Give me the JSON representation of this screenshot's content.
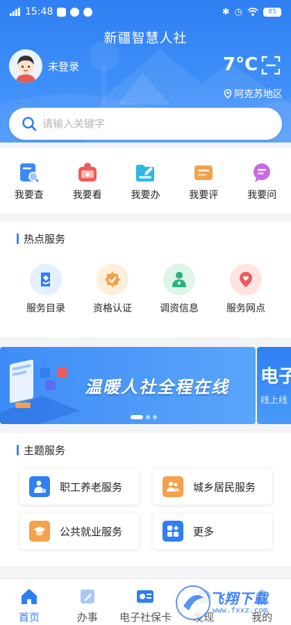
{
  "status_bar": {
    "time": "15:48",
    "battery": "85"
  },
  "header": {
    "app_title": "新疆智慧人社",
    "login_status": "未登录",
    "temperature": "7°C",
    "location": "阿克苏地区"
  },
  "search": {
    "placeholder": "请输入关键字"
  },
  "quick_actions": [
    {
      "label": "我要查",
      "icon": "search-doc-icon"
    },
    {
      "label": "我要看",
      "icon": "monitor-icon"
    },
    {
      "label": "我要办",
      "icon": "folder-edit-icon"
    },
    {
      "label": "我要评",
      "icon": "comment-icon"
    },
    {
      "label": "我要问",
      "icon": "chat-bubble-icon"
    }
  ],
  "hot_services": {
    "title": "热点服务",
    "items": [
      {
        "label": "服务目录",
        "icon": "catalog-icon"
      },
      {
        "label": "资格认证",
        "icon": "certified-badge-icon"
      },
      {
        "label": "调资信息",
        "icon": "person-info-icon"
      },
      {
        "label": "服务网点",
        "icon": "map-pin-icon"
      }
    ]
  },
  "banner": {
    "slide1_text": "温暖人社全程在线",
    "slide2_title": "电子",
    "slide2_subtitle": "线上线",
    "slides_total": 3,
    "active_slide": 1
  },
  "theme_services": {
    "title": "主题服务",
    "items": [
      {
        "label": "职工养老服务",
        "icon": "worker-icon"
      },
      {
        "label": "城乡居民服务",
        "icon": "residents-icon"
      },
      {
        "label": "公共就业服务",
        "icon": "graduation-icon"
      },
      {
        "label": "更多",
        "icon": "grid-more-icon"
      }
    ]
  },
  "tab_bar": [
    {
      "label": "首页",
      "icon": "home-icon",
      "active": true
    },
    {
      "label": "办事",
      "icon": "edit-icon",
      "active": false
    },
    {
      "label": "电子社保卡",
      "icon": "card-icon",
      "active": false
    },
    {
      "label": "发现",
      "icon": "discover-icon",
      "active": false
    },
    {
      "label": "我的",
      "icon": "user-icon",
      "active": false
    }
  ],
  "watermark": {
    "text": "飞翔下载",
    "url": "www.fxxz.com"
  },
  "colors": {
    "primary": "#2f7ff2",
    "orange": "#f5a04a",
    "green": "#26b57a",
    "red": "#ef5a5a"
  }
}
